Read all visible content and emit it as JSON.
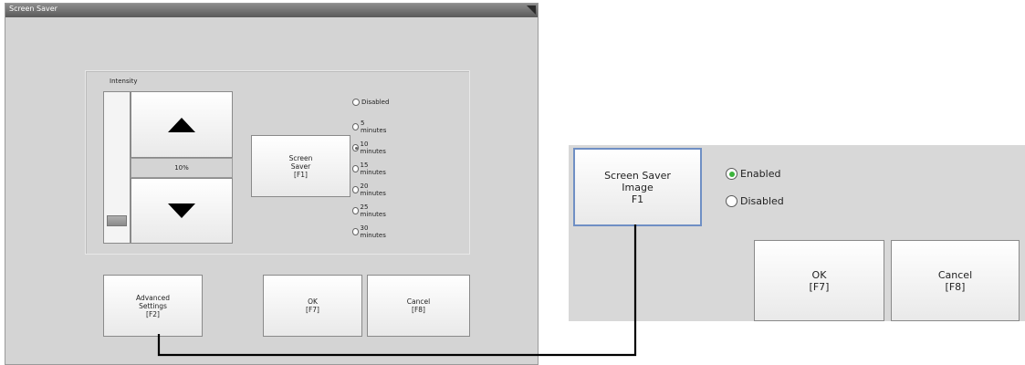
{
  "dialog": {
    "title": "Screen Saver",
    "intensity_label": "Intensity",
    "intensity_value": "10%",
    "intensity_level": 0.1,
    "screen_saver_button": "Screen\nSaver\n[F1]",
    "timeout_options": [
      {
        "label": "Disabled",
        "selected": false
      },
      {
        "label": "5 minutes",
        "selected": false
      },
      {
        "label": "10 minutes",
        "selected": true
      },
      {
        "label": "15 minutes",
        "selected": false
      },
      {
        "label": "20 minutes",
        "selected": false
      },
      {
        "label": "25 minutes",
        "selected": false
      },
      {
        "label": "30 minutes",
        "selected": false
      }
    ],
    "advanced_button": "Advanced\nSettings\n[F2]",
    "ok_button": "OK\n[F7]",
    "cancel_button": "Cancel\n[F8]"
  },
  "image_dialog": {
    "image_button": "Screen Saver\nImage\nF1",
    "options": [
      {
        "label": "Enabled",
        "selected": true
      },
      {
        "label": "Disabled",
        "selected": false
      }
    ],
    "ok_button": "OK\n[F7]",
    "cancel_button": "Cancel\n[F8]"
  },
  "colors": {
    "dialog_bg": "#d4d4d4",
    "titlebar": "#6e6e6e",
    "selected_radio": "#3cb43c",
    "connector_line": "#000000"
  }
}
